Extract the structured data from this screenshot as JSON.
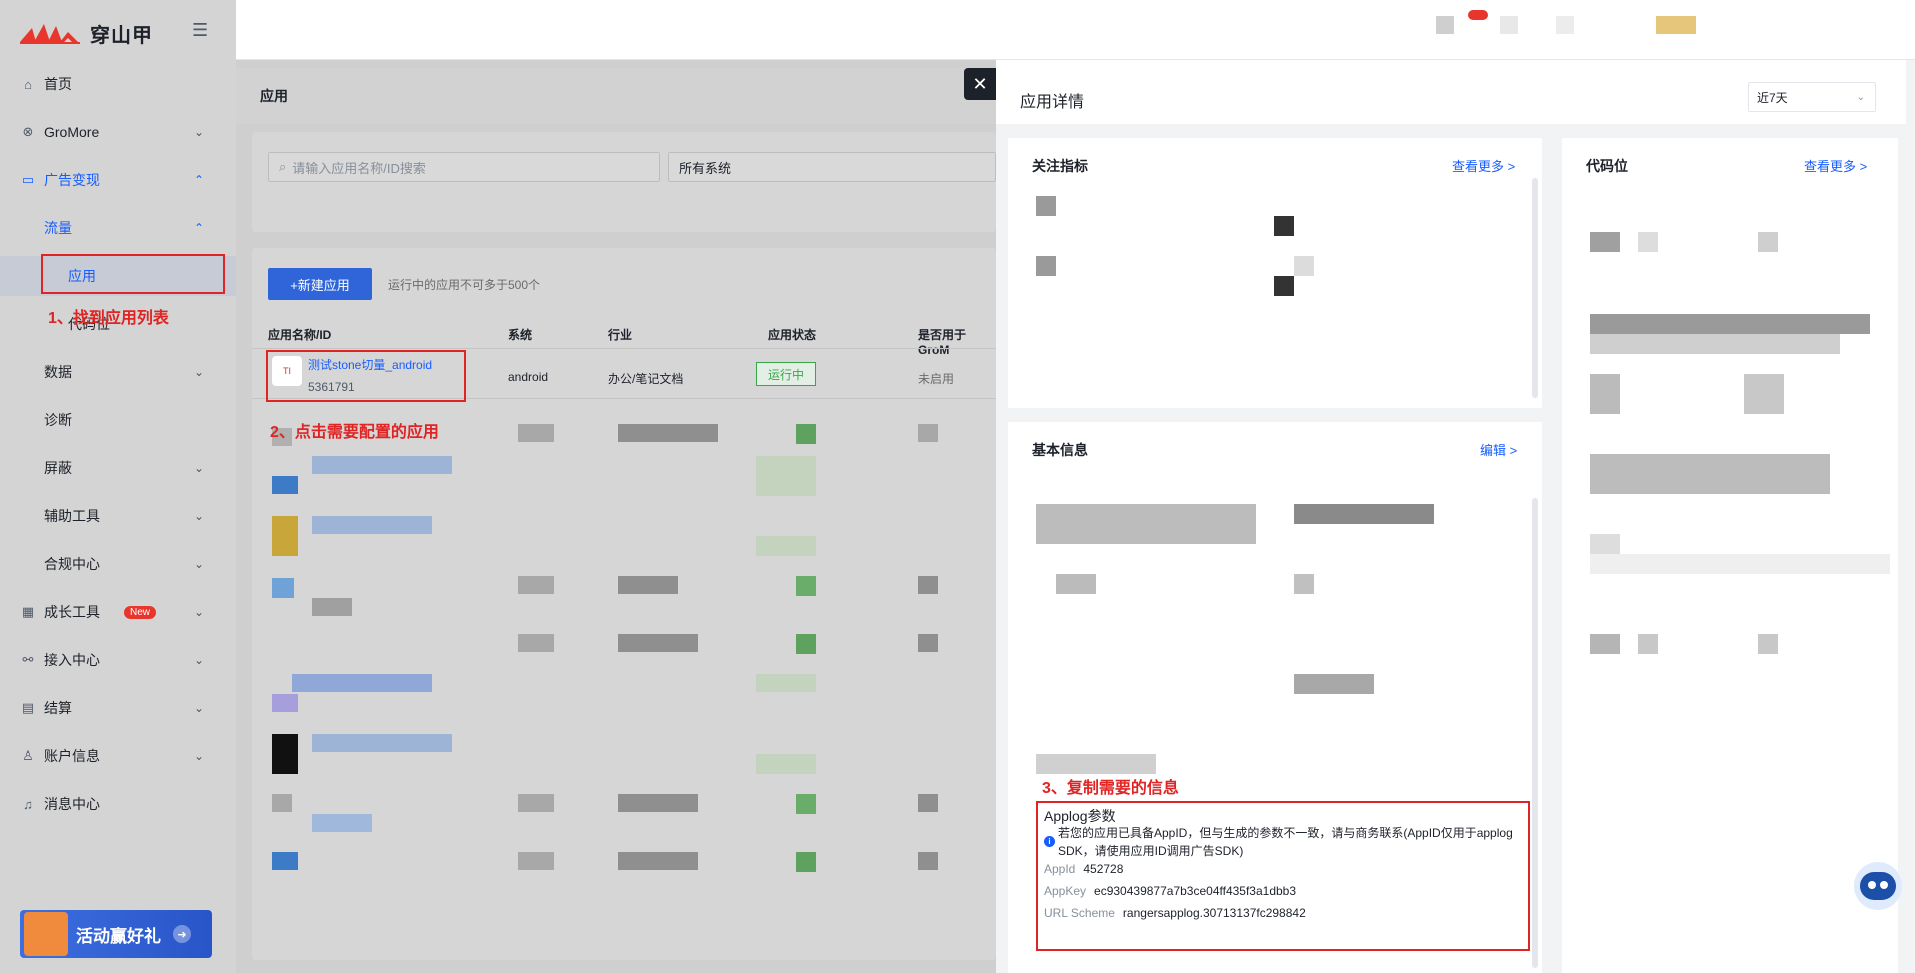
{
  "brand": {
    "name": "穿山甲",
    "accent": "#165dff",
    "logo_color": "#e8362c"
  },
  "sidebar": {
    "items": [
      {
        "label": "首页",
        "icon": "home-icon"
      },
      {
        "label": "GroMore",
        "icon": "gromore-icon"
      },
      {
        "label": "广告变现",
        "icon": "monetize-icon"
      },
      {
        "label": "流量"
      },
      {
        "label": "应用"
      },
      {
        "label": "代码位"
      },
      {
        "label": "数据"
      },
      {
        "label": "诊断"
      },
      {
        "label": "屏蔽"
      },
      {
        "label": "辅助工具"
      },
      {
        "label": "合规中心"
      },
      {
        "label": "成长工具",
        "icon": "grid-icon",
        "badge": "New"
      },
      {
        "label": "接入中心",
        "icon": "link-icon"
      },
      {
        "label": "结算",
        "icon": "wallet-icon"
      },
      {
        "label": "账户信息",
        "icon": "user-icon"
      },
      {
        "label": "消息中心",
        "icon": "bell-icon"
      }
    ],
    "promo_label": "活动赢好礼"
  },
  "main": {
    "title": "应用",
    "search_placeholder": "请输入应用名称/ID搜索",
    "system_select": "所有系统",
    "new_button": "+新建应用",
    "hint": "运行中的应用不可多于500个",
    "columns": [
      "应用名称/ID",
      "系统",
      "行业",
      "应用状态",
      "是否用于GroM"
    ],
    "first_row": {
      "name": "测试stone切量_android",
      "id": "5361791",
      "system": "android",
      "industry": "办公/笔记文档",
      "status": "运行中",
      "gromore": "未启用",
      "icon_text": "TI"
    }
  },
  "drawer": {
    "title": "应用详情",
    "range": "近7天",
    "metrics_title": "关注指标",
    "metrics_link": "查看更多 >",
    "slots_title": "代码位",
    "slots_link": "查看更多 >",
    "basic_title": "基本信息",
    "basic_link": "编辑 >",
    "applog_title": "Applog参数",
    "applog_note": "若您的应用已具备AppID，但与生成的参数不一致，请与商务联系(AppID仅用于applog SDK，请使用应用ID调用广告SDK)",
    "appid_label": "AppId",
    "appid_value": "452728",
    "appkey_label": "AppKey",
    "appkey_value": "ec930439877a7b3ce04ff435f3a1dbb3",
    "scheme_label": "URL Scheme",
    "scheme_value": "rangersapplog.30713137fc298842"
  },
  "annotations": {
    "step1": "1、找到应用列表",
    "step2": "2、点击需要配置的应用",
    "step3": "3、复制需要的信息"
  }
}
